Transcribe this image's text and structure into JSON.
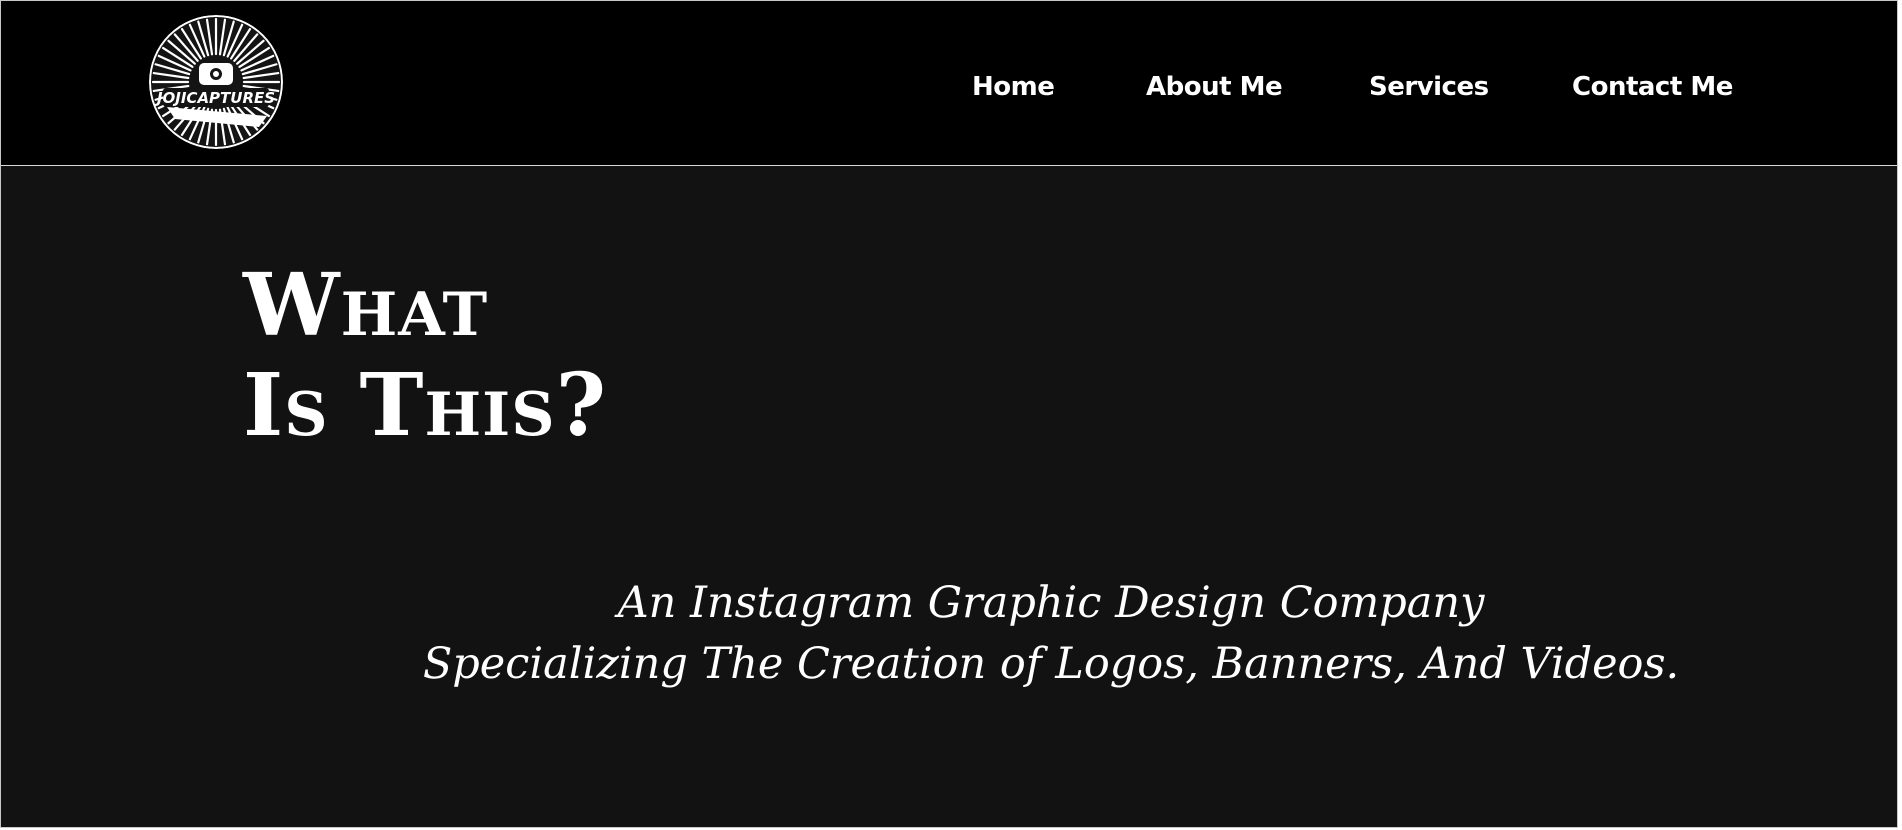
{
  "header": {
    "logo": {
      "text": "JOJICAPTURES",
      "icon": "camera-icon"
    },
    "nav": [
      {
        "label": "Home"
      },
      {
        "label": "About Me"
      },
      {
        "label": "Services"
      },
      {
        "label": "Contact Me"
      }
    ]
  },
  "hero": {
    "title_line1": "What",
    "title_line2": "Is This?",
    "tagline_line1": "An Instagram Graphic Design Company",
    "tagline_line2": "Specializing The Creation of Logos, Banners, And Videos."
  },
  "colors": {
    "header_background": "#000000",
    "page_background": "#121212",
    "text": "#ffffff"
  }
}
